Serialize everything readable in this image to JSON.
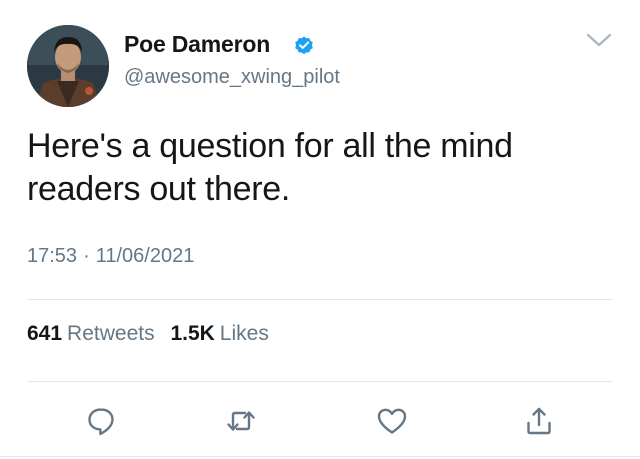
{
  "user": {
    "display_name": "Poe Dameron",
    "handle": "@awesome_xwing_pilot",
    "verified": true
  },
  "tweet": {
    "text": "Here's a question for all the mind readers out there.",
    "time": "17:53",
    "separator": "·",
    "date": "11/06/2021"
  },
  "stats": {
    "retweets_count": "641",
    "retweets_label": "Retweets",
    "likes_count": "1.5K",
    "likes_label": "Likes"
  },
  "actions": [
    "reply-icon",
    "retweet-icon",
    "like-icon",
    "share-icon"
  ],
  "colors": {
    "verified_blue": "#1da1f2",
    "icon_gray": "#657786",
    "text": "#14171a",
    "divider": "#e1e8ed"
  }
}
